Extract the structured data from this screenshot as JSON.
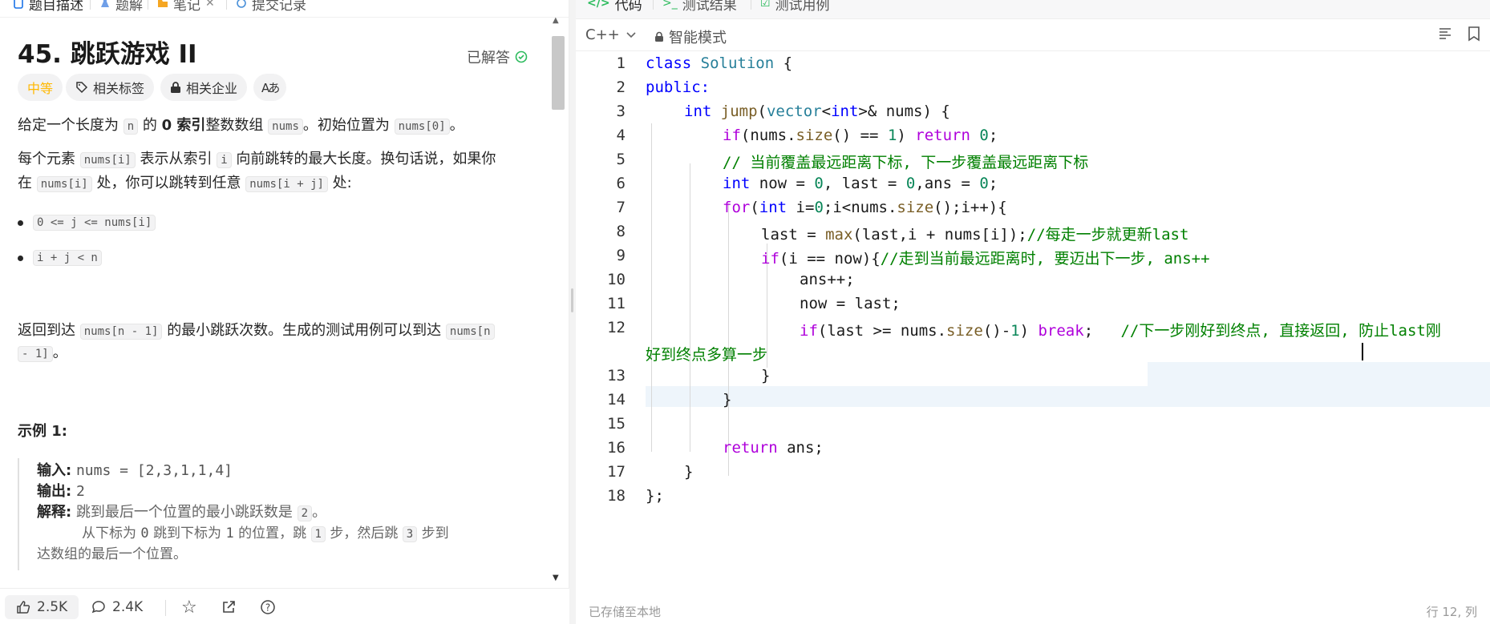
{
  "left_tabs": [
    "题目描述",
    "题解",
    "笔记",
    "提交记录"
  ],
  "problem": {
    "title": "45. 跳跃游戏 II",
    "solved_label": "已解答",
    "difficulty": "中等",
    "chips": [
      "相关标签",
      "相关企业",
      "Aあ"
    ],
    "p1_a": "给定一个长度为",
    "p1_code1": "n",
    "p1_b": "的",
    "p1_bold": "0 索引",
    "p1_c": "整数数组",
    "p1_code2": "nums",
    "p1_d": "。初始位置为",
    "p1_code3": "nums[0]",
    "p1_e": "。",
    "p2_a": "每个元素",
    "p2_code1": "nums[i]",
    "p2_b": "表示从索引",
    "p2_code2": "i",
    "p2_c": "向前跳转的最大长度。换句话说，如果你",
    "p2_d": "在",
    "p2_code3": "nums[i]",
    "p2_e": "处，你可以跳转到任意",
    "p2_code4": "nums[i + j]",
    "p2_f": "处:",
    "bullets": [
      "0 <= j <= nums[i]",
      "i + j < n"
    ],
    "p3_a": "返回到达",
    "p3_code1": "nums[n - 1]",
    "p3_b": "的最小跳跃次数。生成的测试用例可以到达",
    "p3_code2a": "nums[n",
    "p3_code2b": "- 1]",
    "p3_c": "。",
    "example_title": "示例 1:",
    "ex_input_label": "输入:",
    "ex_input_value": "nums = [2,3,1,1,4]",
    "ex_output_label": "输出:",
    "ex_output_value": "2",
    "ex_explain_label": "解释:",
    "ex_explain_a": "跳到最后一个位置的最小跳跃数是",
    "ex_explain_code": "2",
    "ex_explain_b": "。",
    "ex_line2_a": "从下标为",
    "ex_line2_b": "0",
    "ex_line2_c": "跳到下标为",
    "ex_line2_d": "1",
    "ex_line2_e": "的位置，跳",
    "ex_line2_code1": "1",
    "ex_line2_f": "步，然后跳",
    "ex_line2_code2": "3",
    "ex_line2_g": "步到",
    "ex_line3": "达数组的最后一个位置。"
  },
  "bottom_bar": {
    "likes": "2.5K",
    "comments": "2.4K"
  },
  "right_tabs": [
    "代码",
    "测试结果",
    "测试用例"
  ],
  "toolbar": {
    "language": "C++",
    "mode": "智能模式"
  },
  "code": {
    "line_numbers": [
      "1",
      "2",
      "3",
      "4",
      "5",
      "6",
      "7",
      "8",
      "9",
      "10",
      "11",
      "12",
      "13",
      "14",
      "15",
      "16",
      "17",
      "18"
    ],
    "l1_a": "class ",
    "l1_b": "Solution",
    "l1_c": " {",
    "l2": "public:",
    "l3_a": "int ",
    "l3_b": "jump",
    "l3_c": "(",
    "l3_d": "vector",
    "l3_e": "<",
    "l3_f": "int",
    "l3_g": ">& nums) {",
    "l4_a": "if",
    "l4_b": "(nums.",
    "l4_c": "size",
    "l4_d": "() == ",
    "l4_e": "1",
    "l4_f": ") ",
    "l4_g": "return ",
    "l4_h": "0",
    "l4_i": ";",
    "l5": "// 当前覆盖最远距离下标, 下一步覆盖最远距离下标",
    "l6_a": "int ",
    "l6_b": "now = ",
    "l6_c": "0",
    "l6_d": ", last = ",
    "l6_e": "0",
    "l6_f": ",ans = ",
    "l6_g": "0",
    "l6_h": ";",
    "l7_a": "for",
    "l7_b": "(",
    "l7_c": "int ",
    "l7_d": "i=",
    "l7_e": "0",
    "l7_f": ";i<nums.",
    "l7_g": "size",
    "l7_h": "();i++){",
    "l8_a": "last = ",
    "l8_b": "max",
    "l8_c": "(last,i + nums[i]);",
    "l8_d": "//每走一步就更新last",
    "l9_a": "if",
    "l9_b": "(i == now){",
    "l9_c": "//走到当前最远距离时, 要迈出下一步, ans++",
    "l10": "ans++;",
    "l11": "now = last;",
    "l12_a": "if",
    "l12_b": "(last >= nums.",
    "l12_c": "size",
    "l12_d": "()-",
    "l12_e": "1",
    "l12_f": ") ",
    "l12_g": "break",
    "l12_h": ";   ",
    "l12_i": "//下一步刚好到终点, 直接返回, 防止last刚",
    "l12_wrap": "好到终点多算一步",
    "l13": "}",
    "l14": "}",
    "l16_a": "return ",
    "l16_b": "ans;",
    "l17": "}",
    "l18": "};"
  },
  "status": {
    "saved": "已存储至本地",
    "position": "行 12, 列"
  }
}
